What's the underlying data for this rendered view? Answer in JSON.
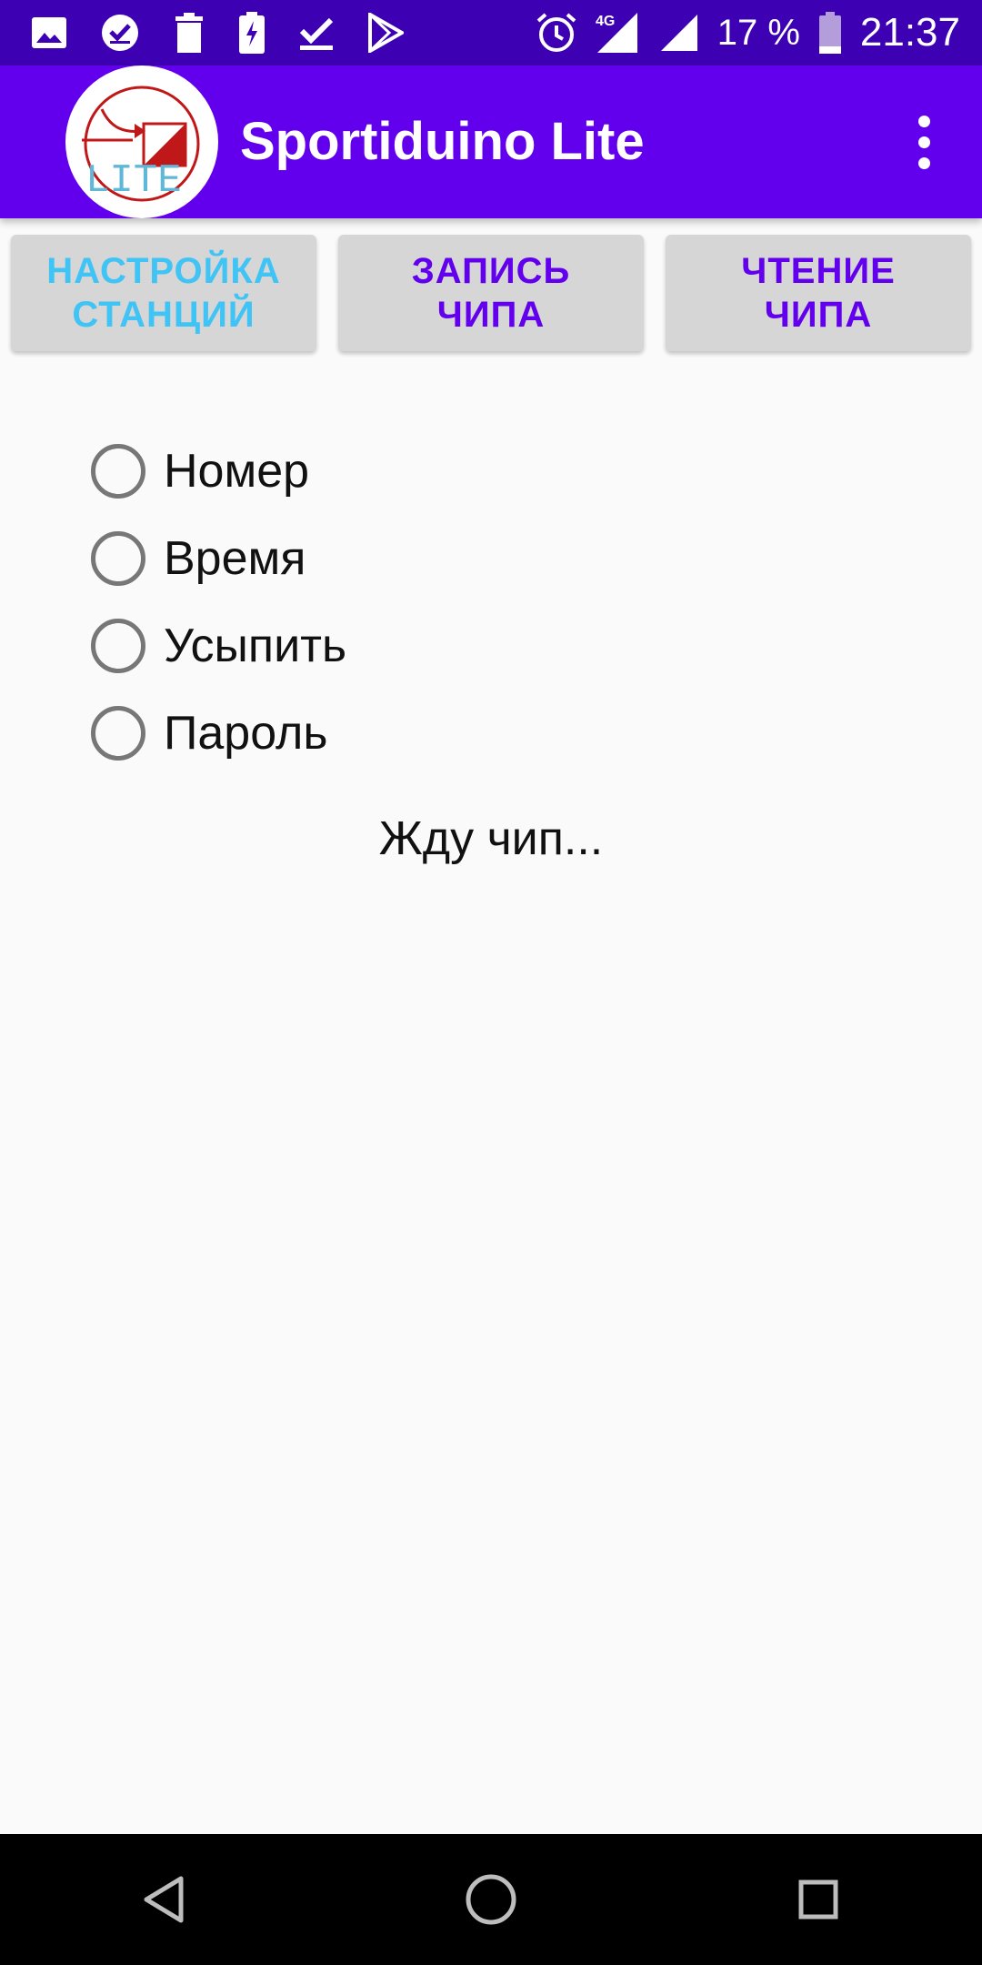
{
  "status_bar": {
    "battery_percent": "17 %",
    "time": "21:37",
    "network_type": "4G",
    "left_icons": [
      "image-icon",
      "check-circle-icon",
      "trash-icon",
      "battery-charging-icon",
      "download-done-icon",
      "play-store-icon"
    ],
    "right_icons": [
      "alarm-icon",
      "signal-4g-icon",
      "signal-icon",
      "battery-icon"
    ]
  },
  "app_bar": {
    "title": "Sportiduino Lite",
    "logo_text": "LITE",
    "overflow_icon": "more-vert-icon"
  },
  "tabs": [
    {
      "label": "НАСТРОЙКА\nСТАНЦИЙ",
      "active": true
    },
    {
      "label": "ЗАПИСЬ\nЧИПА",
      "active": false
    },
    {
      "label": "ЧТЕНИЕ\nЧИПА",
      "active": false
    }
  ],
  "radio_options": [
    {
      "label": "Номер",
      "checked": false
    },
    {
      "label": "Время",
      "checked": false
    },
    {
      "label": "Усыпить",
      "checked": false
    },
    {
      "label": "Пароль",
      "checked": false
    }
  ],
  "status_message": "Жду чип...",
  "nav_bar": {
    "buttons": [
      "back-icon",
      "home-icon",
      "recents-icon"
    ]
  },
  "colors": {
    "status_bar_bg": "#3d00b3",
    "app_bar_bg": "#6200ee",
    "tab_active_text": "#40c4f5",
    "tab_text": "#6200ee",
    "tab_bg": "#d6d6d6"
  }
}
